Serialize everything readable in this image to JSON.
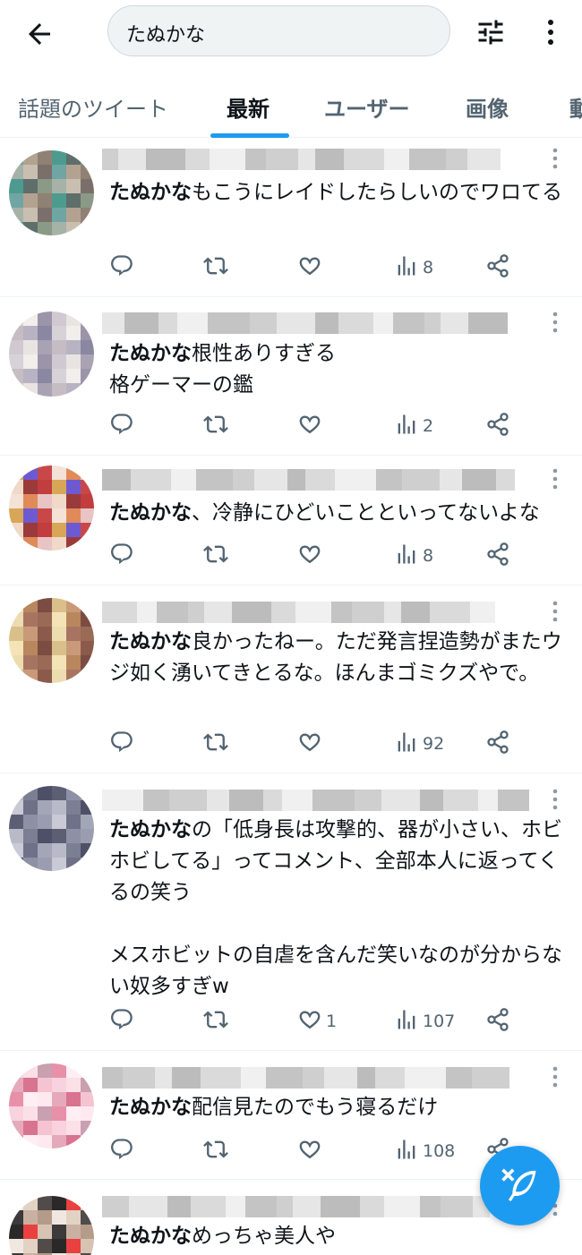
{
  "search": {
    "query": "たぬかな"
  },
  "tabs": [
    {
      "label": "話題のツイート"
    },
    {
      "label": "最新"
    },
    {
      "label": "ユーザー"
    },
    {
      "label": "画像"
    },
    {
      "label": "動"
    }
  ],
  "tweets": [
    {
      "highlight": "たぬかな",
      "rest": "もこうにレイドしたらしいのでワロてる",
      "replies": "",
      "retweets": "",
      "likes": "",
      "views": "8"
    },
    {
      "highlight": "たぬかな",
      "rest": "根性ありすぎる\n格ゲーマーの鑑",
      "replies": "",
      "retweets": "",
      "likes": "",
      "views": "2"
    },
    {
      "highlight": "たぬかな",
      "rest": "、冷静にひどいことといってないよな",
      "replies": "",
      "retweets": "",
      "likes": "",
      "views": "8"
    },
    {
      "highlight": "たぬかな",
      "rest": "良かったねー。ただ発言捏造勢がまたウジ如く湧いてきとるな。ほんまゴミクズやで。",
      "replies": "",
      "retweets": "",
      "likes": "",
      "views": "92"
    },
    {
      "highlight": "たぬかな",
      "rest": "の「低身長は攻撃的、器が小さい、ホビホビしてる」ってコメント、全部本人に返ってくるの笑う\n\nメスホビットの自虐を含んだ笑いなのが分からない奴多すぎw",
      "replies": "",
      "retweets": "",
      "likes": "1",
      "views": "107"
    },
    {
      "highlight": "たぬかな",
      "rest": "配信見たのでもう寝るだけ",
      "replies": "",
      "retweets": "",
      "likes": "",
      "views": "108"
    },
    {
      "highlight": "たぬかな",
      "rest": "めっちゃ美人や",
      "replies": "",
      "retweets": "",
      "likes": "",
      "views": ""
    }
  ],
  "icons": {
    "back": "arrow-left-icon",
    "filter": "sliders-icon",
    "more": "more-vertical-icon",
    "reply": "reply-icon",
    "retweet": "retweet-icon",
    "like": "heart-icon",
    "views": "views-chart-icon",
    "share": "share-icon",
    "compose": "compose-feather-icon"
  },
  "colors": {
    "accent": "#1d9bf0",
    "secondary_text": "#536471",
    "divider": "#eff3f4"
  }
}
